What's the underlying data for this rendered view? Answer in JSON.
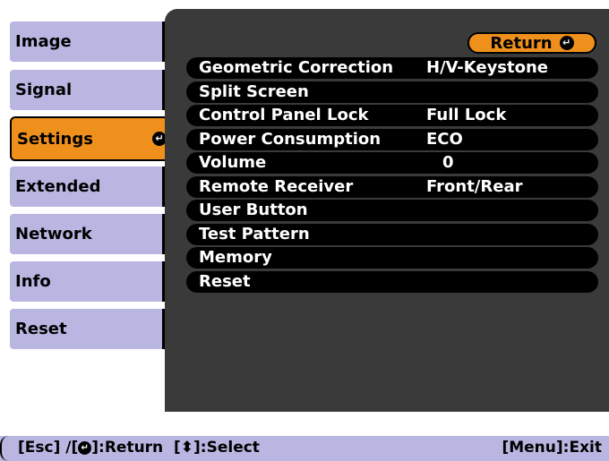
{
  "menu": {
    "items": [
      {
        "label": "Image"
      },
      {
        "label": "Signal"
      },
      {
        "label": "Settings"
      },
      {
        "label": "Extended"
      },
      {
        "label": "Network"
      },
      {
        "label": "Info"
      },
      {
        "label": "Reset"
      }
    ],
    "selected": "Settings"
  },
  "panel": {
    "return_label": "Return",
    "rows": [
      {
        "label": "Geometric Correction",
        "value": "H/V-Keystone"
      },
      {
        "label": "Split Screen",
        "value": ""
      },
      {
        "label": "Control Panel Lock",
        "value": "Full Lock"
      },
      {
        "label": "Power Consumption",
        "value": "ECO"
      },
      {
        "label": "Volume",
        "value": "0"
      },
      {
        "label": "Remote Receiver",
        "value": "Front/Rear"
      },
      {
        "label": "User Button",
        "value": ""
      },
      {
        "label": "Test Pattern",
        "value": ""
      },
      {
        "label": "Memory",
        "value": ""
      },
      {
        "label": "Reset",
        "value": ""
      }
    ]
  },
  "footer": {
    "esc": "[Esc] /[",
    "return_text": "]:Return",
    "select_prefix": "[",
    "select_text": "]:Select",
    "exit_text": "[Menu]:Exit"
  },
  "colors": {
    "menu_bg": "#b9b6e2",
    "active": "#f0901c",
    "panel": "#3a3a3a",
    "row": "#000000"
  },
  "icons": {
    "enter": "enter-icon",
    "updown": "up-down-arrow-icon"
  }
}
